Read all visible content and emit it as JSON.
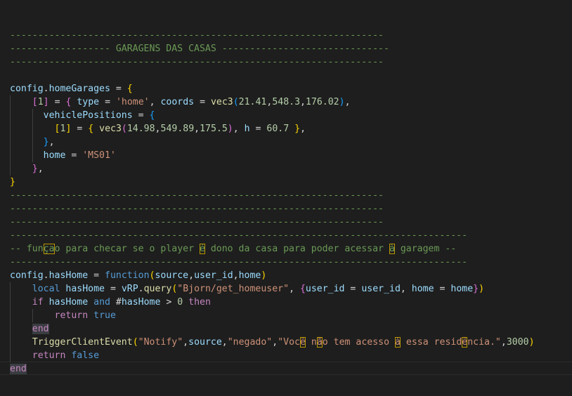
{
  "colors": {
    "background": "#1e1e1e",
    "comment": "#6a9955",
    "variable": "#9cdcfe",
    "function": "#dcdcaa",
    "string": "#ce9178",
    "number": "#b5cea8",
    "keyword": "#569cd6",
    "control": "#c586c0",
    "bracket_1": "#ffd700",
    "bracket_2": "#da70d6",
    "bracket_3": "#179fff"
  },
  "lines": [
    [
      [
        "c",
        "-------------------------------------------------------------------"
      ]
    ],
    [
      [
        "c",
        "------------------ GARAGENS DAS CASAS ------------------------------"
      ]
    ],
    [
      [
        "c",
        "-------------------------------------------------------------------"
      ]
    ],
    [],
    [
      [
        "v",
        "config"
      ],
      [
        "o",
        "."
      ],
      [
        "v",
        "homeGarages"
      ],
      [
        "o",
        " = "
      ],
      [
        "b1",
        "{"
      ]
    ],
    [
      [
        "o",
        "    "
      ],
      [
        "b2",
        "["
      ],
      [
        "n",
        "1"
      ],
      [
        "b2",
        "]"
      ],
      [
        "o",
        " = "
      ],
      [
        "b2",
        "{"
      ],
      [
        "o",
        " "
      ],
      [
        "v",
        "type"
      ],
      [
        "o",
        " = "
      ],
      [
        "s",
        "'home'"
      ],
      [
        "o",
        ", "
      ],
      [
        "v",
        "coords"
      ],
      [
        "o",
        " = "
      ],
      [
        "f",
        "vec3"
      ],
      [
        "b3",
        "("
      ],
      [
        "n",
        "21.41"
      ],
      [
        "o",
        ","
      ],
      [
        "n",
        "548.3"
      ],
      [
        "o",
        ","
      ],
      [
        "n",
        "176.02"
      ],
      [
        "b3",
        ")"
      ],
      [
        "o",
        ","
      ]
    ],
    [
      [
        "o",
        "      "
      ],
      [
        "v",
        "vehiclePositions"
      ],
      [
        "o",
        " = "
      ],
      [
        "b3",
        "{"
      ]
    ],
    [
      [
        "o",
        "        "
      ],
      [
        "b1",
        "["
      ],
      [
        "n",
        "1"
      ],
      [
        "b1",
        "]"
      ],
      [
        "o",
        " = "
      ],
      [
        "b1",
        "{"
      ],
      [
        "o",
        " "
      ],
      [
        "f",
        "vec3"
      ],
      [
        "b2",
        "("
      ],
      [
        "n",
        "14.98"
      ],
      [
        "o",
        ","
      ],
      [
        "n",
        "549.89"
      ],
      [
        "o",
        ","
      ],
      [
        "n",
        "175.5"
      ],
      [
        "b2",
        ")"
      ],
      [
        "o",
        ", "
      ],
      [
        "v",
        "h"
      ],
      [
        "o",
        " = "
      ],
      [
        "n",
        "60.7"
      ],
      [
        "o",
        " "
      ],
      [
        "b1",
        "}"
      ],
      [
        "o",
        ","
      ]
    ],
    [
      [
        "o",
        "      "
      ],
      [
        "b3",
        "}"
      ],
      [
        "o",
        ","
      ]
    ],
    [
      [
        "o",
        "      "
      ],
      [
        "v",
        "home"
      ],
      [
        "o",
        " = "
      ],
      [
        "s",
        "'MS01'"
      ]
    ],
    [
      [
        "o",
        "    "
      ],
      [
        "b2",
        "}"
      ],
      [
        "o",
        ","
      ]
    ],
    [
      [
        "b1",
        "}"
      ]
    ],
    [
      [
        "c",
        "-------------------------------------------------------------------"
      ]
    ],
    [
      [
        "c",
        "-------------------------------------------------------------------"
      ]
    ],
    [
      [
        "c",
        "-------------------------------------------------------------------"
      ]
    ],
    [
      [
        "c",
        "----------------------------------------------------------------------------------"
      ]
    ],
    [
      [
        "c",
        "-- fun"
      ],
      [
        "cb",
        "ça"
      ],
      [
        "c",
        "o para checar se o player "
      ],
      [
        "cb",
        "é"
      ],
      [
        "c",
        " dono da casa para poder acessar "
      ],
      [
        "cb",
        "à"
      ],
      [
        "c",
        " garagem --"
      ]
    ],
    [
      [
        "c",
        "----------------------------------------------------------------------------------"
      ]
    ],
    [
      [
        "v",
        "config"
      ],
      [
        "o",
        "."
      ],
      [
        "v",
        "hasHome"
      ],
      [
        "o",
        " = "
      ],
      [
        "k",
        "function"
      ],
      [
        "b1",
        "("
      ],
      [
        "v",
        "source"
      ],
      [
        "o",
        ","
      ],
      [
        "v",
        "user_id"
      ],
      [
        "o",
        ","
      ],
      [
        "v",
        "home"
      ],
      [
        "b1",
        ")"
      ]
    ],
    [
      [
        "o",
        "    "
      ],
      [
        "k",
        "local"
      ],
      [
        "o",
        " "
      ],
      [
        "v",
        "hasHome"
      ],
      [
        "o",
        " = "
      ],
      [
        "v",
        "vRP"
      ],
      [
        "o",
        "."
      ],
      [
        "f",
        "query"
      ],
      [
        "b1",
        "("
      ],
      [
        "s",
        "\"Bjorn/get_homeuser\""
      ],
      [
        "o",
        ", "
      ],
      [
        "b2",
        "{"
      ],
      [
        "v",
        "user_id"
      ],
      [
        "o",
        " = "
      ],
      [
        "v",
        "user_id"
      ],
      [
        "o",
        ", "
      ],
      [
        "v",
        "home"
      ],
      [
        "o",
        " = "
      ],
      [
        "v",
        "home"
      ],
      [
        "b2",
        "}"
      ],
      [
        "b1",
        ")"
      ]
    ],
    [
      [
        "o",
        "    "
      ],
      [
        "x",
        "if"
      ],
      [
        "o",
        " "
      ],
      [
        "v",
        "hasHome"
      ],
      [
        "o",
        " "
      ],
      [
        "k",
        "and"
      ],
      [
        "o",
        " #"
      ],
      [
        "v",
        "hasHome"
      ],
      [
        "o",
        " > "
      ],
      [
        "n",
        "0"
      ],
      [
        "o",
        " "
      ],
      [
        "x",
        "then"
      ]
    ],
    [
      [
        "o",
        "        "
      ],
      [
        "x",
        "return"
      ],
      [
        "o",
        " "
      ],
      [
        "k",
        "true"
      ]
    ],
    [
      [
        "o",
        "    "
      ],
      [
        "xe",
        "end"
      ]
    ],
    [
      [
        "o",
        "    "
      ],
      [
        "f",
        "TriggerClientEvent"
      ],
      [
        "b1",
        "("
      ],
      [
        "s",
        "\"Notify\""
      ],
      [
        "o",
        ","
      ],
      [
        "v",
        "source"
      ],
      [
        "o",
        ","
      ],
      [
        "s",
        "\"negado\""
      ],
      [
        "o",
        ","
      ],
      [
        "s",
        "\"Voc"
      ],
      [
        "sb",
        "ê"
      ],
      [
        "s",
        " n"
      ],
      [
        "sb",
        "ã"
      ],
      [
        "s",
        "o tem acesso "
      ],
      [
        "sb",
        "à"
      ],
      [
        "s",
        " essa resid"
      ],
      [
        "sb",
        "ê"
      ],
      [
        "s",
        "ncia.\""
      ],
      [
        "o",
        ","
      ],
      [
        "n",
        "3000"
      ],
      [
        "b1",
        ")"
      ]
    ],
    [
      [
        "o",
        "    "
      ],
      [
        "x",
        "return"
      ],
      [
        "o",
        " "
      ],
      [
        "k",
        "false"
      ]
    ],
    [
      [
        "xe",
        "end"
      ]
    ]
  ]
}
